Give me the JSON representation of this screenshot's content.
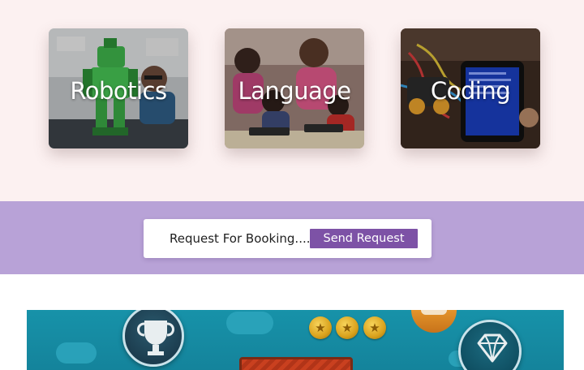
{
  "cards": [
    {
      "label": "Robotics",
      "icon": "robot-photo"
    },
    {
      "label": "Language",
      "icon": "children-photo"
    },
    {
      "label": "Coding",
      "icon": "tablet-photo"
    }
  ],
  "booking": {
    "text": "Request For Booking.....",
    "button_label": "Send Request",
    "band_color": "#b8a2d7",
    "button_color": "#7d52a6"
  },
  "game": {
    "icons": [
      "trophy-icon",
      "coin-icon",
      "coin-icon",
      "coin-icon",
      "bag-icon",
      "diamond-icon"
    ],
    "coin_symbol": "★"
  }
}
